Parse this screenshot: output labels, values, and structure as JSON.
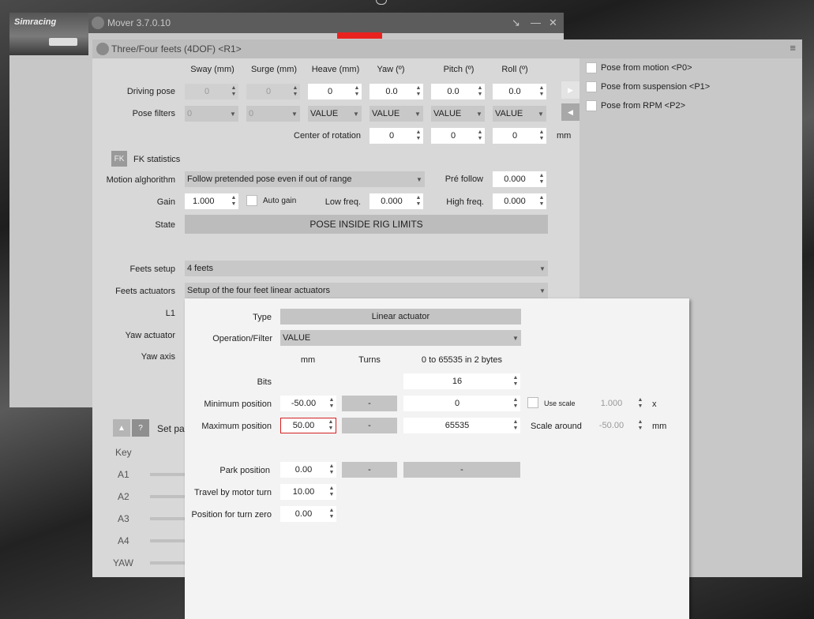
{
  "back_window": {
    "title": "Mover 3.7.0.10",
    "logo": "Simracing"
  },
  "main_window": {
    "title": "Three/Four feets (4DOF) <R1>",
    "menu_glyph": "≡"
  },
  "columns": [
    "Sway (mm)",
    "Surge (mm)",
    "Heave (mm)",
    "Yaw (º)",
    "Pitch (º)",
    "Roll (º)"
  ],
  "driving_pose": {
    "label": "Driving pose",
    "values": [
      "0",
      "0",
      "0",
      "0.0",
      "0.0",
      "0.0"
    ]
  },
  "pose_filters": {
    "label": "Pose filters",
    "values": [
      "0",
      "0",
      "VALUE",
      "VALUE",
      "VALUE",
      "VALUE"
    ]
  },
  "center_rotation": {
    "label": "Center of rotation",
    "values": [
      "0",
      "0",
      "0"
    ],
    "unit": "mm"
  },
  "fk": {
    "badge": "FK",
    "label": "FK statistics"
  },
  "motion": {
    "label": "Motion alghorithm",
    "value": "Follow pretended pose even if out of range",
    "prefollow_label": "Pré follow",
    "prefollow_value": "0.000"
  },
  "gain": {
    "label": "Gain",
    "value": "1.000",
    "auto_label": "Auto gain",
    "low_label": "Low freq.",
    "low_value": "0.000",
    "high_label": "High freq.",
    "high_value": "0.000"
  },
  "state": {
    "label": "State",
    "value": "POSE INSIDE RIG LIMITS"
  },
  "feets_setup": {
    "label": "Feets setup",
    "value": "4 feets"
  },
  "feets_actuators": {
    "label": "Feets actuators",
    "value": "Setup of the four feet linear actuators"
  },
  "hidden_labels": {
    "l1": "L1",
    "yaw_actuator": "Yaw actuator",
    "yaw_axis": "Yaw axis"
  },
  "bottom": {
    "help": "?",
    "setpar": "Set par",
    "key": "Key",
    "rows": [
      "A1",
      "A2",
      "A3",
      "A4",
      "YAW"
    ]
  },
  "right_options": [
    "Pose from motion <P0>",
    "Pose from suspension <P1>",
    "Pose from RPM <P2>"
  ],
  "popup": {
    "type_label": "Type",
    "type_value": "Linear actuator",
    "op_label": "Operation/Filter",
    "op_value": "VALUE",
    "col_mm": "mm",
    "col_turns": "Turns",
    "col_bytes": "0 to 65535 in 2 bytes",
    "bits_label": "Bits",
    "bits_value": "16",
    "min_label": "Minimum position",
    "min_mm": "-50.00",
    "min_turns": "-",
    "min_raw": "0",
    "use_scale_label": "Use scale",
    "scale_value": "1.000",
    "scale_unit": "x",
    "max_label": "Maximum position",
    "max_mm": "50.00",
    "max_turns": "-",
    "max_raw": "65535",
    "scale_around_label": "Scale around",
    "scale_around_value": "-50.00",
    "scale_around_unit": "mm",
    "park_label": "Park position",
    "park_mm": "0.00",
    "park_turns": "-",
    "park_raw": "-",
    "travel_label": "Travel by motor turn",
    "travel_value": "10.00",
    "turnzero_label": "Position for turn zero",
    "turnzero_value": "0.00"
  },
  "colors": {
    "accent_red": "#e8231f",
    "panel": "#d8d8d8",
    "popup": "#f3f3f3"
  }
}
